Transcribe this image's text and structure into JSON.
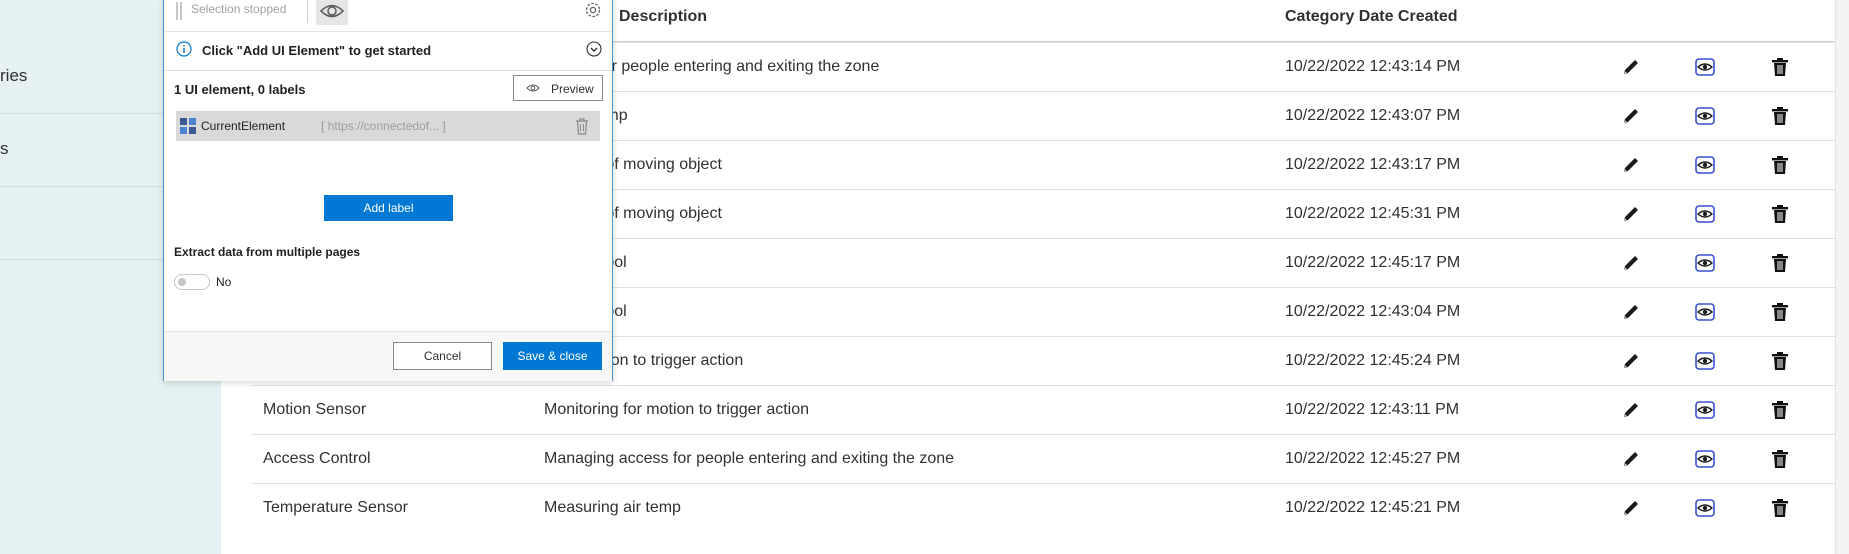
{
  "sidebar": {
    "items": [
      {
        "label": "ries"
      },
      {
        "label": "s"
      },
      {
        "label": ""
      }
    ]
  },
  "table": {
    "headers": {
      "description": "Description",
      "date_created": "Category Date Created"
    },
    "rows": [
      {
        "name": "",
        "description": "access for people entering and exiting the zone",
        "date": "10/22/2022 12:43:14 PM"
      },
      {
        "name": "",
        "description": "ing air temp",
        "date": "10/22/2022 12:43:07 PM"
      },
      {
        "name": "",
        "description": "g speed of moving object",
        "date": "10/22/2022 12:43:17 PM"
      },
      {
        "name": "",
        "description": "g speed of moving object",
        "date": "10/22/2022 12:45:31 PM"
      },
      {
        "name": "",
        "description": "nitoring tool",
        "date": "10/22/2022 12:45:17 PM"
      },
      {
        "name": "",
        "description": "nitoring tool",
        "date": "10/22/2022 12:43:04 PM"
      },
      {
        "name": "",
        "description": "g for motion to trigger action",
        "date": "10/22/2022 12:45:24 PM"
      },
      {
        "name": "Motion Sensor",
        "description": "Monitoring for motion to trigger action",
        "date": "10/22/2022 12:43:11 PM"
      },
      {
        "name": "Access Control",
        "description": "Managing access for people entering and exiting the zone",
        "date": "10/22/2022 12:45:27 PM"
      },
      {
        "name": "Temperature Sensor",
        "description": "Measuring air temp",
        "date": "10/22/2022 12:45:21 PM"
      }
    ],
    "action_icons": [
      "pencil-icon",
      "eye-icon",
      "trash-icon"
    ]
  },
  "dialog": {
    "toolbar_status": "Selection stopped",
    "info_text": "Click \"Add UI Element\" to get started",
    "count_text": "1 UI element, 0 labels",
    "preview_label": "Preview",
    "element_name": "CurrentElement",
    "element_url": "[ https://connectedof... ]",
    "add_label": "Add label",
    "extract_label": "Extract data from multiple pages",
    "toggle_label": "No",
    "toggle_on": false,
    "cancel_label": "Cancel",
    "save_label": "Save & close"
  },
  "colors": {
    "accent": "#0078d4",
    "sidebar_bg": "#e5f1f3",
    "view_icon": "#3a4fd0"
  }
}
